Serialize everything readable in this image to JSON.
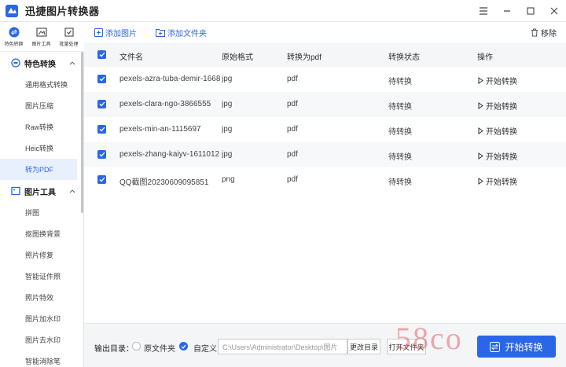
{
  "app": {
    "title": "迅捷图片转换器"
  },
  "window": {
    "min": "—",
    "restore": "☐",
    "close": "✕"
  },
  "topnav": [
    {
      "label": "特色转换"
    },
    {
      "label": "图片工具"
    },
    {
      "label": "批量处理"
    }
  ],
  "sidebar": {
    "group1": {
      "label": "特色转换",
      "items": [
        "通用格式转换",
        "图片压缩",
        "Raw转换",
        "Heic转换",
        "转为PDF"
      ]
    },
    "group2": {
      "label": "图片工具",
      "items": [
        "拼图",
        "抠图换背景",
        "照片修复",
        "智能证件照",
        "照片特效",
        "图片加水印",
        "图片去水印",
        "智能消除笔"
      ]
    }
  },
  "toolbar": {
    "add_image": "添加图片",
    "add_folder": "添加文件夹",
    "clear": "移除"
  },
  "table": {
    "headers": {
      "name": "文件名",
      "format": "原始格式",
      "target": "转换为pdf",
      "status": "转换状态",
      "action": "操作"
    },
    "rows": [
      {
        "name": "pexels-azra-tuba-demir-1668...",
        "format": "jpg",
        "target": "pdf",
        "status": "待转换",
        "action": "开始转换"
      },
      {
        "name": "pexels-clara-ngo-3866555",
        "format": "jpg",
        "target": "pdf",
        "status": "待转换",
        "action": "开始转换"
      },
      {
        "name": "pexels-min-an-1115697",
        "format": "jpg",
        "target": "pdf",
        "status": "待转换",
        "action": "开始转换"
      },
      {
        "name": "pexels-zhang-kaiyv-16110121",
        "format": "jpg",
        "target": "pdf",
        "status": "待转换",
        "action": "开始转换"
      },
      {
        "name": "QQ截图20230609095851",
        "format": "png",
        "target": "pdf",
        "status": "待转换",
        "action": "开始转换"
      }
    ]
  },
  "bottom": {
    "output_label": "输出目录：",
    "opt_source": "原文件夹",
    "opt_custom": "自定义",
    "path_value": "C:\\Users\\Administrator\\Desktop\\图片",
    "change_btn": "更改目录",
    "open_btn": "打开文件夹",
    "start_btn": "开始转换"
  },
  "watermark": "58co",
  "colors": {
    "accent": "#2a66e8"
  }
}
